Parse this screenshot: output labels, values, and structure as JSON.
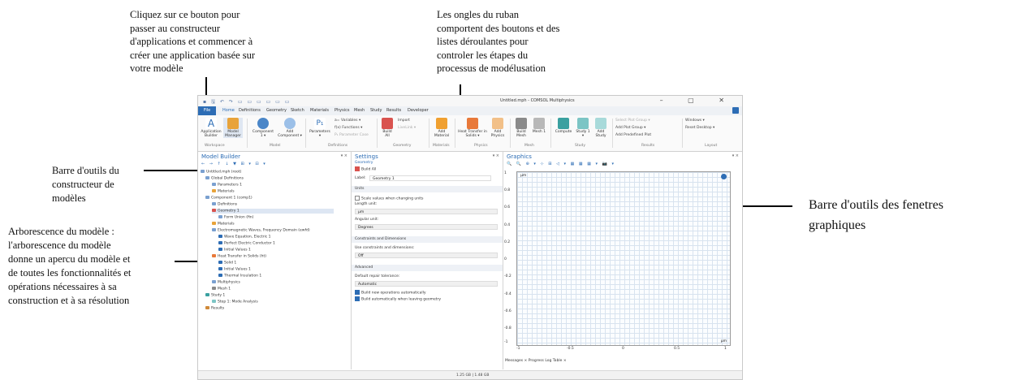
{
  "annotations": {
    "app_builder": [
      "Cliquez sur ce bouton pour",
      "passer au constructeur",
      "d'applications et commencer à",
      "créer une application basée sur",
      "votre modèle"
    ],
    "ribbon_tabs": [
      "Les ongles du ruban",
      "comportent des boutons et des",
      "listes déroulantes pour",
      "controler les étapes du",
      "processus de modélusation"
    ],
    "model_toolbar": [
      "Barre d'outils du",
      "constructeur de",
      "modèles"
    ],
    "model_tree": [
      "Arborescence du modèle :",
      "l'arborescence du modèle",
      "donne un apercu du modèle et",
      "de toutes les fonctionnalités et",
      "opérations nécessaires à sa",
      "construction et à sa résolution"
    ],
    "graphics_toolbar": [
      "Barre d'outils des fenetres",
      "graphiques"
    ]
  },
  "window": {
    "title": "Untitled.mph - COMSOL Multiphysics",
    "controls": "– ▢ ✕",
    "quick_access": "▪ 🖫 ↶ ↷ ▭ ▭ ▭ ▭ ▭ ▭"
  },
  "ribbon_tabs": [
    "File",
    "Home",
    "Definitions",
    "Geometry",
    "Sketch",
    "Materials",
    "Physics",
    "Mesh",
    "Study",
    "Results",
    "Developer"
  ],
  "ribbon": {
    "application_builder": "Application Builder",
    "model_manager": "Model Manager",
    "component": "Component 1 ▾",
    "add_component": "Add Component ▾",
    "parameters": "Parameters ▾",
    "variables": "a= Variables ▾",
    "functions": "f(x) Functions ▾",
    "parameter_case": "P₁ Parameter Case",
    "build_all": "Build All",
    "import": "Import",
    "livelink": "LiveLink ▾",
    "add_material": "Add Material",
    "heat_transfer": "Heat Transfer in Solids ▾",
    "add_physics": "Add Physics",
    "build_mesh": "Build Mesh",
    "mesh1": "Mesh 1",
    "compute": "Compute",
    "study": "Study 1 ▾",
    "add_study": "Add Study",
    "select_plot_group": "Select Plot Group ▾",
    "add_plot_group": "Add Plot Group ▾",
    "add_predefined_plot": "Add Predefined Plot",
    "windows": "Windows ▾",
    "reset_desktop": "Reset Desktop ▾",
    "groups": [
      "Workspace",
      "Model",
      "Definitions",
      "Geometry",
      "Materials",
      "Physics",
      "Mesh",
      "Study",
      "Results",
      "Layout"
    ]
  },
  "model_builder": {
    "title": "Model Builder",
    "toolbar": "← → ↑ ↓ ▼ ⊞ ▾ ⊟ ▾",
    "tree": [
      "Untitled.mph (root)",
      "Global Definitions",
      "Parameters 1",
      "Materials",
      "Component 1 (comp1)",
      "Definitions",
      "Geometry 1",
      "Form Union (fin)",
      "Materials",
      "Electromagnetic Waves, Frequency Domain (ewfd)",
      "Wave Equation, Electric 1",
      "Perfect Electric Conductor 1",
      "Initial Values 1",
      "Heat Transfer in Solids (ht)",
      "Solid 1",
      "Initial Values 1",
      "Thermal Insulation 1",
      "Multiphysics",
      "Mesh 1",
      "Study 1",
      "Step 1: Mode Analysis",
      "Results"
    ]
  },
  "settings": {
    "title": "Settings",
    "subtitle": "Geometry",
    "build_all": "Build All",
    "label_text": "Label:",
    "label_value": "Geometry 1",
    "units_header": "Units",
    "scale_values": "Scale values when changing units",
    "length_unit": "Length unit:",
    "length_value": "µm",
    "angular_unit": "Angular unit:",
    "angular_value": "Degrees",
    "constraints_header": "Constraints and Dimensions",
    "use_constraints": "Use constraints and dimensions:",
    "constraints_value": "Off",
    "advanced_header": "Advanced",
    "repair_tolerance": "Default repair tolerance:",
    "repair_value": "Automatic",
    "build_new": "Build new operations automatically",
    "build_auto": "Build automatically when leaving geometry"
  },
  "graphics": {
    "title": "Graphics",
    "toolbar": "🔍 🔍 ⊕ ▾ ⊹ ⊞ ◁ ▾ ▦ ▦ ▦ ▾ 📷 ▾",
    "y_ticks": [
      "1",
      "0.8",
      "0.6",
      "0.4",
      "0.2",
      "0",
      "-0.2",
      "-0.4",
      "-0.6",
      "-0.8",
      "-1"
    ],
    "x_ticks": [
      "-1",
      "-0.5",
      "0",
      "0.5",
      "1"
    ],
    "unit_top": "µm",
    "unit_bottom": "µm",
    "bottom_tabs": "Messages ×   Progress   Log   Table ×"
  },
  "status_bar": "1.25 GB | 1.48 GB"
}
